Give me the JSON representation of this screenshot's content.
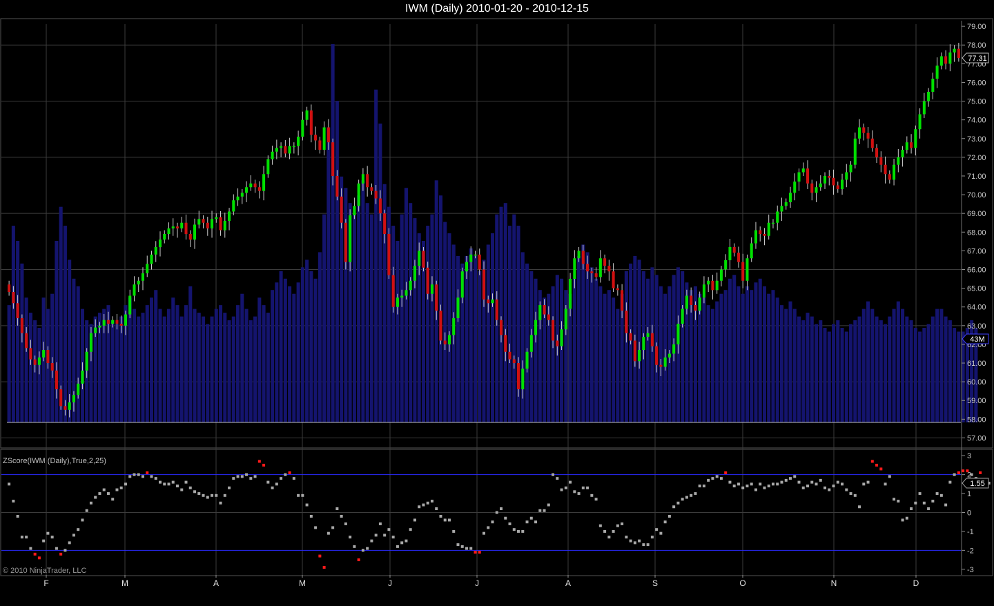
{
  "title": "IWM (Daily)  2010-01-20 - 2010-12-15",
  "indicator_label": "ZScore(IWM (Daily),True,2,25)",
  "copyright": "© 2010 NinjaTrader, LLC",
  "price_marker": "77.31",
  "volume_marker": "43M",
  "zscore_marker": "1.55",
  "colors": {
    "background": "#000000",
    "grid": "#3c3c3c",
    "up_candle": "#00e000",
    "down_candle": "#d01010",
    "volume": "#14146e",
    "zscore_normal": "#a8a8a8",
    "zscore_extreme": "#ff1a1a",
    "band_line": "#2a2aff"
  },
  "chart_data": [
    {
      "type": "candlestick",
      "title": "IWM (Daily)  2010-01-20 - 2010-12-15",
      "x_tick_labels": [
        "F",
        "M",
        "A",
        "M",
        "J",
        "J",
        "A",
        "S",
        "O",
        "N",
        "D"
      ],
      "y_tick_labels": [
        "57.00",
        "58.00",
        "59.00",
        "60.00",
        "61.00",
        "62.00",
        "63.00",
        "64.00",
        "65.00",
        "66.00",
        "67.00",
        "68.00",
        "69.00",
        "70.00",
        "71.00",
        "72.00",
        "73.00",
        "74.00",
        "75.00",
        "76.00",
        "77.00",
        "78.00",
        "79.00"
      ],
      "ylim": [
        56.5,
        79.3
      ],
      "grid": true,
      "last_price": 77.31,
      "close_series": [
        64.8,
        64.2,
        63.4,
        62.6,
        61.8,
        61.2,
        60.9,
        61.3,
        61.7,
        61.0,
        60.6,
        59.6,
        58.7,
        58.5,
        58.9,
        59.3,
        59.9,
        60.6,
        61.6,
        62.6,
        62.9,
        63.0,
        63.3,
        63.1,
        63.3,
        63.1,
        63.0,
        63.6,
        64.6,
        65.2,
        65.4,
        65.8,
        66.3,
        66.8,
        67.2,
        67.6,
        67.9,
        68.2,
        68.3,
        68.2,
        68.5,
        67.9,
        67.6,
        68.4,
        68.7,
        68.5,
        68.2,
        68.7,
        68.8,
        68.1,
        68.6,
        69.1,
        69.7,
        69.9,
        70.1,
        70.4,
        70.6,
        70.4,
        70.2,
        71.1,
        71.9,
        72.3,
        72.5,
        72.6,
        72.2,
        72.6,
        72.6,
        73.1,
        74.0,
        74.5,
        73.2,
        72.9,
        72.4,
        73.6,
        72.8,
        71.0,
        69.9,
        68.5,
        66.4,
        68.9,
        69.4,
        70.6,
        71.1,
        70.4,
        70.2,
        69.8,
        69.0,
        67.9,
        65.7,
        64.0,
        64.5,
        64.6,
        64.9,
        65.4,
        66.2,
        67.0,
        66.1,
        64.7,
        65.2,
        63.8,
        62.2,
        62.0,
        62.5,
        63.4,
        64.5,
        65.9,
        66.4,
        66.8,
        66.8,
        66.0,
        64.4,
        64.2,
        64.4,
        63.3,
        62.5,
        61.6,
        61.2,
        61.0,
        59.6,
        60.7,
        61.6,
        62.5,
        63.3,
        64.1,
        63.6,
        63.3,
        62.2,
        61.9,
        62.8,
        63.9,
        65.5,
        66.6,
        67.0,
        66.3,
        65.9,
        65.8,
        65.6,
        66.6,
        66.2,
        65.9,
        65.0,
        64.9,
        63.8,
        62.6,
        62.2,
        61.1,
        61.7,
        62.4,
        62.6,
        61.9,
        60.9,
        60.8,
        61.3,
        61.5,
        62.0,
        63.1,
        63.9,
        64.6,
        64.1,
        63.8,
        64.5,
        65.2,
        65.4,
        64.9,
        65.4,
        66.0,
        66.5,
        67.2,
        66.9,
        66.4,
        65.4,
        66.6,
        67.4,
        68.1,
        67.9,
        67.8,
        68.5,
        68.5,
        69.1,
        69.4,
        69.6,
        70.1,
        70.7,
        71.2,
        71.4,
        70.6,
        70.1,
        70.4,
        70.6,
        71.0,
        70.9,
        70.5,
        70.3,
        70.8,
        71.2,
        71.6,
        73.0,
        73.6,
        73.3,
        73.0,
        72.5,
        72.0,
        71.6,
        71.1,
        70.8,
        71.6,
        72.0,
        72.4,
        72.8,
        72.5,
        73.5,
        74.3,
        75.0,
        75.5,
        76.2,
        76.9,
        77.4,
        77.0,
        77.6,
        77.8,
        77.31
      ],
      "volume_axis_label": "43M",
      "volume_relative": [
        0.31,
        0.52,
        0.48,
        0.42,
        0.33,
        0.29,
        0.27,
        0.25,
        0.33,
        0.3,
        0.34,
        0.48,
        0.57,
        0.52,
        0.43,
        0.38,
        0.36,
        0.3,
        0.27,
        0.26,
        0.28,
        0.29,
        0.3,
        0.31,
        0.27,
        0.26,
        0.28,
        0.31,
        0.33,
        0.3,
        0.28,
        0.29,
        0.31,
        0.33,
        0.35,
        0.3,
        0.28,
        0.3,
        0.33,
        0.31,
        0.28,
        0.31,
        0.36,
        0.3,
        0.29,
        0.28,
        0.26,
        0.28,
        0.3,
        0.31,
        0.29,
        0.27,
        0.28,
        0.31,
        0.34,
        0.3,
        0.27,
        0.28,
        0.33,
        0.31,
        0.29,
        0.35,
        0.37,
        0.4,
        0.38,
        0.36,
        0.34,
        0.37,
        0.41,
        0.43,
        0.4,
        0.38,
        0.45,
        0.55,
        0.78,
        1.0,
        0.85,
        0.65,
        0.62,
        0.58,
        0.55,
        0.6,
        0.64,
        0.58,
        0.55,
        0.88,
        0.79,
        0.63,
        0.57,
        0.52,
        0.48,
        0.55,
        0.62,
        0.58,
        0.54,
        0.5,
        0.48,
        0.52,
        0.55,
        0.64,
        0.6,
        0.53,
        0.5,
        0.47,
        0.44,
        0.42,
        0.44,
        0.46,
        0.44,
        0.4,
        0.43,
        0.47,
        0.5,
        0.55,
        0.57,
        0.58,
        0.52,
        0.55,
        0.52,
        0.45,
        0.42,
        0.4,
        0.38,
        0.35,
        0.33,
        0.34,
        0.36,
        0.39,
        0.38,
        0.35,
        0.34,
        0.38,
        0.44,
        0.47,
        0.45,
        0.41,
        0.38,
        0.36,
        0.34,
        0.35,
        0.33,
        0.3,
        0.34,
        0.4,
        0.42,
        0.44,
        0.43,
        0.4,
        0.38,
        0.41,
        0.39,
        0.36,
        0.34,
        0.36,
        0.39,
        0.41,
        0.4,
        0.37,
        0.35,
        0.36,
        0.34,
        0.33,
        0.31,
        0.3,
        0.32,
        0.34,
        0.35,
        0.38,
        0.39,
        0.36,
        0.34,
        0.36,
        0.35,
        0.37,
        0.38,
        0.36,
        0.34,
        0.35,
        0.33,
        0.31,
        0.3,
        0.32,
        0.3,
        0.28,
        0.27,
        0.29,
        0.28,
        0.26,
        0.27,
        0.25,
        0.24,
        0.26,
        0.27,
        0.25,
        0.24,
        0.26,
        0.27,
        0.28,
        0.3,
        0.32,
        0.3,
        0.28,
        0.27,
        0.26,
        0.28,
        0.3,
        0.32,
        0.3,
        0.28,
        0.27,
        0.25,
        0.24,
        0.25,
        0.26,
        0.28,
        0.3,
        0.3,
        0.28,
        0.27,
        0.25,
        0.24,
        0.24,
        0.25,
        0.27,
        0.25
      ]
    },
    {
      "type": "scatter",
      "title": "ZScore(IWM (Daily),True,2,25)",
      "y_tick_labels": [
        "3",
        "2",
        "1",
        "0",
        "-1",
        "-2",
        "-3"
      ],
      "ylim": [
        -3.3,
        3.3
      ],
      "bands": [
        2,
        -2
      ],
      "grid": true,
      "last_value": 1.55,
      "values": [
        1.5,
        0.6,
        -0.2,
        -1.3,
        -1.3,
        -1.9,
        -2.2,
        -2.4,
        -1.5,
        -1.1,
        -1.3,
        -1.9,
        -2.2,
        -2.0,
        -1.6,
        -1.2,
        -0.9,
        -0.4,
        0.1,
        0.5,
        0.8,
        1.0,
        1.2,
        1.0,
        0.7,
        1.2,
        1.3,
        1.5,
        1.9,
        2.0,
        2.0,
        1.9,
        2.1,
        1.9,
        1.8,
        1.6,
        1.5,
        1.5,
        1.6,
        1.4,
        1.2,
        1.6,
        1.3,
        1.1,
        1.0,
        0.9,
        0.8,
        0.9,
        0.9,
        0.5,
        0.9,
        1.3,
        1.8,
        1.9,
        1.9,
        2.0,
        1.8,
        1.9,
        2.7,
        2.5,
        1.6,
        1.3,
        1.5,
        1.8,
        2.0,
        2.1,
        1.8,
        0.9,
        0.9,
        0.4,
        -0.2,
        -0.8,
        -2.3,
        -2.9,
        -1.1,
        -0.8,
        0.2,
        -0.2,
        -0.6,
        -1.3,
        -1.8,
        -2.5,
        -2.0,
        -1.9,
        -1.5,
        -1.2,
        -0.6,
        -1.2,
        -0.9,
        -1.3,
        -1.8,
        -1.6,
        -1.5,
        -0.9,
        -0.4,
        0.3,
        0.4,
        0.5,
        0.6,
        0.2,
        -0.2,
        -0.4,
        -0.4,
        -1.0,
        -1.7,
        -1.8,
        -1.9,
        -1.9,
        -2.1,
        -2.1,
        -1.1,
        -0.8,
        -0.5,
        0.0,
        0.2,
        -0.3,
        -0.6,
        -0.9,
        -1.0,
        -1.0,
        -0.5,
        -0.3,
        -0.5,
        0.1,
        0.1,
        0.4,
        2.0,
        1.8,
        1.2,
        1.3,
        1.6,
        1.1,
        1.0,
        1.3,
        1.3,
        0.9,
        0.7,
        -0.7,
        -1.0,
        -1.3,
        -1.0,
        -0.7,
        -0.6,
        -1.3,
        -1.5,
        -1.6,
        -1.5,
        -1.7,
        -1.7,
        -1.3,
        -0.9,
        -1.1,
        -0.5,
        -0.2,
        0.3,
        0.5,
        0.7,
        0.8,
        0.9,
        1.0,
        1.4,
        1.4,
        1.7,
        1.8,
        1.9,
        1.8,
        2.1,
        1.6,
        1.4,
        1.5,
        1.3,
        1.4,
        1.5,
        1.2,
        1.5,
        1.3,
        1.4,
        1.5,
        1.5,
        1.6,
        1.7,
        1.8,
        1.9,
        1.6,
        1.3,
        1.4,
        1.6,
        1.5,
        1.7,
        1.3,
        1.2,
        1.4,
        1.6,
        1.5,
        1.2,
        1.0,
        0.9,
        0.3,
        1.5,
        1.6,
        2.7,
        2.5,
        2.3,
        1.5,
        1.9,
        0.7,
        0.6,
        -0.4,
        -0.3,
        0.2,
        0.5,
        1.0,
        0.5,
        0.2,
        0.6,
        1.0,
        0.9,
        0.4,
        1.6,
        2.0,
        2.1,
        2.2,
        2.2,
        2.0,
        1.8,
        2.1,
        1.7,
        1.55
      ],
      "x_tick_labels": [
        "F",
        "M",
        "A",
        "M",
        "J",
        "J",
        "A",
        "S",
        "O",
        "N",
        "D"
      ]
    }
  ]
}
